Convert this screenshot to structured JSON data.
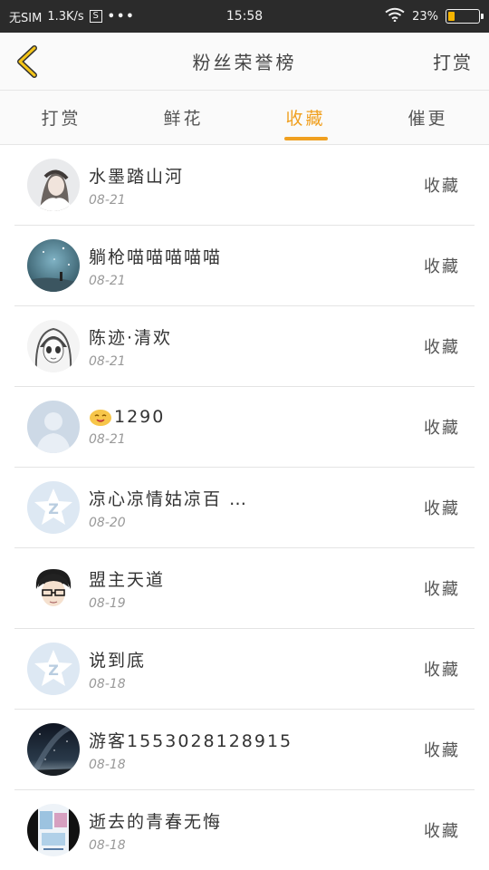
{
  "status_bar": {
    "carrier": "无SIM",
    "speed": "1.3K/s",
    "s_icon": "S",
    "dots": "•••",
    "time": "15:58",
    "battery_text": "23%",
    "battery_level": 0.23
  },
  "header": {
    "title": "粉丝荣誉榜",
    "action": "打赏"
  },
  "tabs": [
    {
      "label": "打赏"
    },
    {
      "label": "鲜花"
    },
    {
      "label": "收藏"
    },
    {
      "label": "催更"
    }
  ],
  "active_tab": "收藏",
  "colors": {
    "accent": "#f0a020",
    "statusbar": "#2b2b2b"
  },
  "rows": [
    {
      "name": "水墨踏山河",
      "date": "08-21",
      "action": "收藏",
      "avatar": "avatar-girl-ink"
    },
    {
      "name": "躺枪喵喵喵喵喵",
      "date": "08-21",
      "action": "收藏",
      "avatar": "avatar-blue-night"
    },
    {
      "name": "陈迹·清欢",
      "date": "08-21",
      "action": "收藏",
      "avatar": "avatar-sketch-girl"
    },
    {
      "name": "1290",
      "date": "08-21",
      "action": "收藏",
      "avatar": "avatar-default-person",
      "emoji": "smile-emoji"
    },
    {
      "name": "凉心凉情姑凉百 …",
      "date": "08-20",
      "action": "收藏",
      "avatar": "avatar-qq-default"
    },
    {
      "name": "盟主天道",
      "date": "08-19",
      "action": "收藏",
      "avatar": "avatar-anime-boy"
    },
    {
      "name": "说到底",
      "date": "08-18",
      "action": "收藏",
      "avatar": "avatar-qq-default"
    },
    {
      "name": "游客1553028128915",
      "date": "08-18",
      "action": "收藏",
      "avatar": "avatar-starry-sky"
    },
    {
      "name": "逝去的青春无悔",
      "date": "08-18",
      "action": "收藏",
      "avatar": "avatar-poster"
    }
  ]
}
